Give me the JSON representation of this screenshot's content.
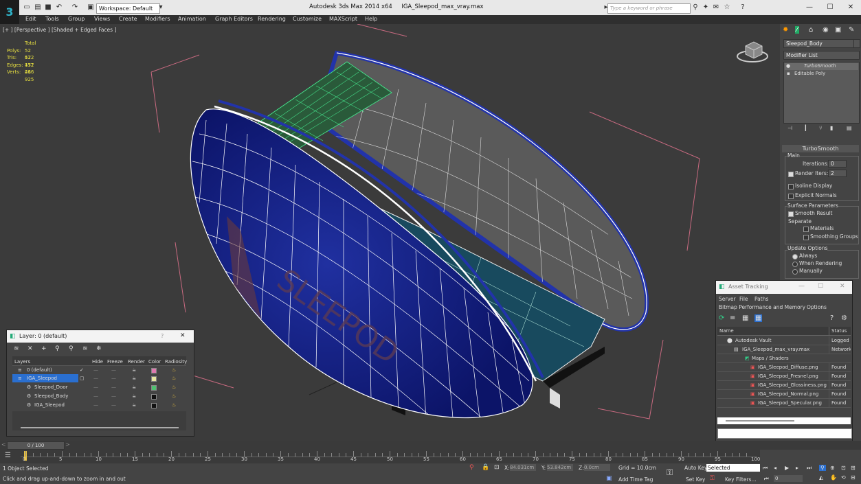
{
  "titlebar": {
    "app_title": "Autodesk 3ds Max  2014 x64",
    "file_name": "IGA_Sleepod_max_vray.max",
    "workspace": "Workspace: Default",
    "search_placeholder": "Type a keyword or phrase",
    "minimize": "—",
    "maximize": "☐",
    "close": "✕"
  },
  "menu": [
    "Edit",
    "Tools",
    "Group",
    "Views",
    "Create",
    "Modifiers",
    "Animation",
    "Graph Editors",
    "Rendering",
    "Customize",
    "MAXScript",
    "Help"
  ],
  "viewport": {
    "label": "[+ ] [Perspective ] [Shaded + Edged Faces ]",
    "stats_header": "Total",
    "stats": [
      {
        "label": "Polys:",
        "value": "52 472"
      },
      {
        "label": "Tris:",
        "value": "52 472"
      },
      {
        "label": "Edges:",
        "value": "157 416"
      },
      {
        "label": "Verts:",
        "value": "26 925"
      }
    ]
  },
  "command_panel": {
    "object_name": "Sleepod_Body",
    "modifier_list": "Modifier List",
    "stack": [
      "TurboSmooth",
      "Editable Poly"
    ],
    "rollout_title": "TurboSmooth",
    "main_group": "Main",
    "iterations_label": "Iterations:",
    "iterations_value": "0",
    "render_iters_label": "Render Iters:",
    "render_iters_value": "2",
    "isoline": "Isoline Display",
    "explicit_normals": "Explicit Normals",
    "surface_params": "Surface Parameters",
    "smooth_result": "Smooth Result",
    "separate": "Separate",
    "materials": "Materials",
    "smoothing_groups": "Smoothing Groups",
    "update_options": "Update Options",
    "always": "Always",
    "when_rendering": "When Rendering",
    "manually": "Manually"
  },
  "layer_dialog": {
    "title": "Layer: 0 (default)",
    "help": "?",
    "close": "✕",
    "columns": [
      "Layers",
      "Hide",
      "Freeze",
      "Render",
      "Color",
      "Radiosity"
    ],
    "rows": [
      {
        "name": "0 (default)",
        "color": "#e07ab0"
      },
      {
        "name": "IGA_Sleepod",
        "color": "#e6e6a0"
      },
      {
        "name": "Sleepod_Door",
        "color": "#4fc070"
      },
      {
        "name": "Sleepod_Body",
        "color": "#111111"
      },
      {
        "name": "IGA_Sleepod",
        "color": "#111111"
      }
    ]
  },
  "asset_tracking": {
    "title": "Asset Tracking",
    "menu": [
      "Server",
      "File",
      "Paths"
    ],
    "menu2": [
      "Bitmap Performance and Memory",
      "Options"
    ],
    "col_name": "Name",
    "col_status": "Status",
    "rows": [
      {
        "name": "Autodesk Vault",
        "status": "Logged O"
      },
      {
        "name": "IGA_Sleepod_max_vray.max",
        "status": "Network"
      },
      {
        "name": "Maps / Shaders",
        "status": ""
      },
      {
        "name": "IGA_Sleepod_Diffuse.png",
        "status": "Found"
      },
      {
        "name": "IGA_Sleepod_Fresnel.png",
        "status": "Found"
      },
      {
        "name": "IGA_Sleepod_Glossiness.png",
        "status": "Found"
      },
      {
        "name": "IGA_Sleepod_Normal.png",
        "status": "Found"
      },
      {
        "name": "IGA_Sleepod_Specular.png",
        "status": "Found"
      }
    ]
  },
  "timeline": {
    "frame": "0 / 100",
    "ticks": [
      "0",
      "5",
      "10",
      "15",
      "20",
      "25",
      "30",
      "35",
      "40",
      "45",
      "50",
      "55",
      "60",
      "65",
      "70",
      "75",
      "80",
      "85",
      "90",
      "95",
      "100"
    ]
  },
  "status": {
    "selection": "1 Object Selected",
    "prompt": "Click and drag up-and-down to zoom in and out",
    "x_label": "X:",
    "x_value": "84.031cm",
    "y_label": "Y:",
    "y_value": "53.842cm",
    "z_label": "Z:",
    "z_value": "0.0cm",
    "grid": "Grid = 10.0cm",
    "auto_key": "Auto Key",
    "selected": "Selected",
    "set_key": "Set Key",
    "key_filters": "Key Filters...",
    "add_time_tag": "Add Time Tag",
    "frame_field": "0"
  },
  "colors": {
    "accent": "#2fb3c9",
    "pod_blue": "#16208a",
    "wire": "#ffffff",
    "selection_green": "#44dd88"
  },
  "model_text": "SLEEPOD"
}
